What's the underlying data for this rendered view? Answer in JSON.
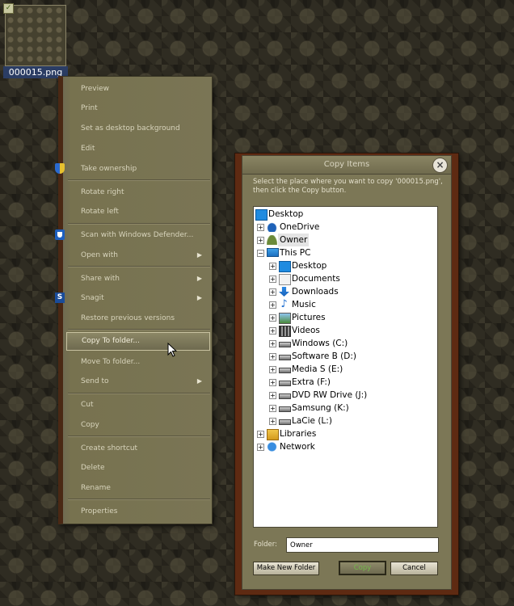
{
  "desktop": {
    "file_name": "000015.png"
  },
  "context_menu": {
    "items": [
      {
        "label": "Preview"
      },
      {
        "label": "Print"
      },
      {
        "label": "Set as desktop background"
      },
      {
        "label": "Edit"
      },
      {
        "label": "Take ownership"
      },
      {
        "label": "Rotate right"
      },
      {
        "label": "Rotate left"
      },
      {
        "label": "Scan with Windows Defender..."
      },
      {
        "label": "Open with"
      },
      {
        "label": "Share with"
      },
      {
        "label": "Snagit"
      },
      {
        "label": "Restore previous versions"
      },
      {
        "label": "Copy To folder..."
      },
      {
        "label": "Move To folder..."
      },
      {
        "label": "Send to"
      },
      {
        "label": "Cut"
      },
      {
        "label": "Copy"
      },
      {
        "label": "Create shortcut"
      },
      {
        "label": "Delete"
      },
      {
        "label": "Rename"
      },
      {
        "label": "Properties"
      }
    ]
  },
  "dialog": {
    "title": "Copy Items",
    "description": "Select the place where you want to copy '000015.png', then click the Copy button.",
    "tree": [
      {
        "label": "Desktop",
        "icon": "desktop-icon"
      },
      {
        "label": "OneDrive",
        "icon": "cloud-icon"
      },
      {
        "label": "Owner",
        "icon": "user-folder-icon"
      },
      {
        "label": "This PC",
        "icon": "computer-icon"
      },
      {
        "label": "Desktop",
        "icon": "desktop-icon"
      },
      {
        "label": "Documents",
        "icon": "documents-icon"
      },
      {
        "label": "Downloads",
        "icon": "downloads-icon"
      },
      {
        "label": "Music",
        "icon": "music-icon"
      },
      {
        "label": "Pictures",
        "icon": "pictures-icon"
      },
      {
        "label": "Videos",
        "icon": "videos-icon"
      },
      {
        "label": "Windows (C:)",
        "icon": "drive-icon"
      },
      {
        "label": "Software B (D:)",
        "icon": "drive-icon"
      },
      {
        "label": "Media S (E:)",
        "icon": "drive-icon"
      },
      {
        "label": "Extra (F:)",
        "icon": "drive-icon"
      },
      {
        "label": "DVD RW Drive (J:)",
        "icon": "dvd-drive-icon"
      },
      {
        "label": "Samsung (K:)",
        "icon": "drive-icon"
      },
      {
        "label": "LaCie (L:)",
        "icon": "drive-icon"
      },
      {
        "label": "Libraries",
        "icon": "libraries-icon"
      },
      {
        "label": "Network",
        "icon": "network-icon"
      }
    ],
    "folder_label": "Folder:",
    "folder_value": "Owner",
    "buttons": {
      "make_new_folder": "Make New Folder",
      "copy": "Copy",
      "cancel": "Cancel"
    },
    "close_glyph": "×"
  },
  "colors": {
    "menu_bg": "#7a7555",
    "dialog_frame": "#5e2a12",
    "copy_text": "#74b84a"
  }
}
